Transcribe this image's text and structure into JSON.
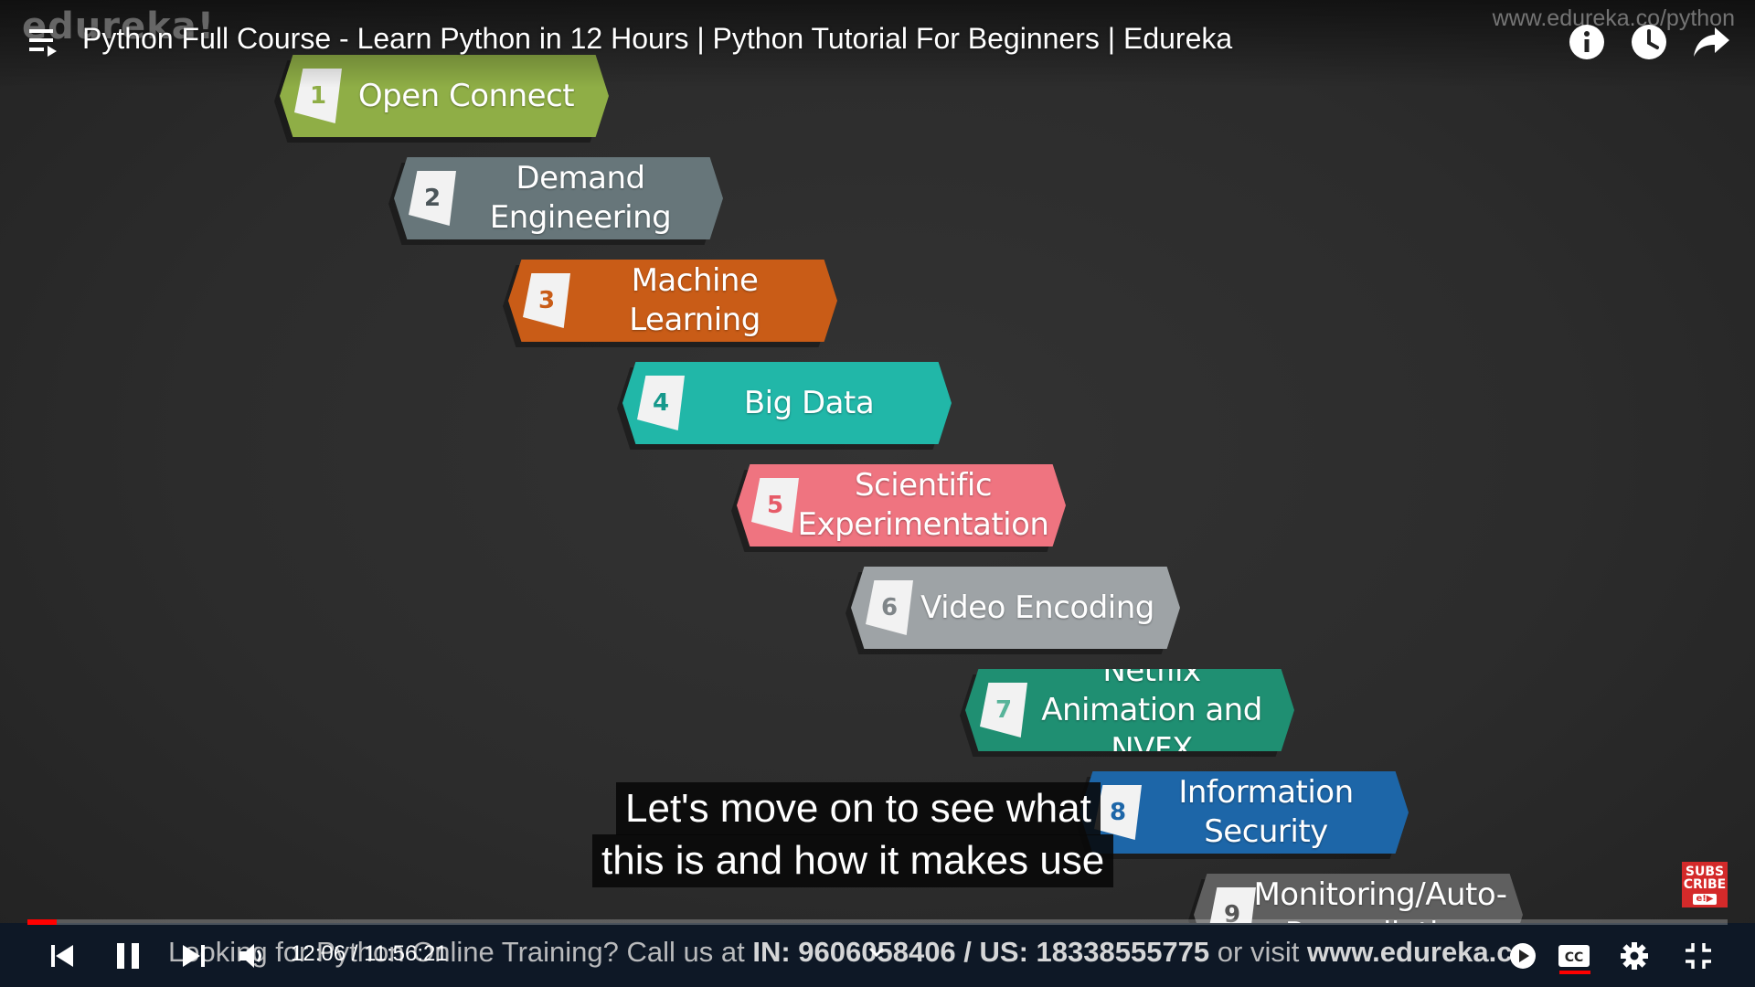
{
  "header": {
    "brand": "edureka!",
    "watermark_url": "www.edureka.co/python",
    "title": "Python Full Course - Learn Python in 12 Hours | Python Tutorial For Beginners | Edureka"
  },
  "icons": {
    "playlist": "playlist-icon",
    "info": "info-icon",
    "watch_later": "clock-icon",
    "share": "share-icon",
    "prev": "skip-previous-icon",
    "pause": "pause-icon",
    "next": "skip-next-icon",
    "volume": "volume-icon",
    "chevron": "chevron-down-icon",
    "autoplay": "autoplay-toggle-icon",
    "cc": "closed-captions-icon",
    "settings": "gear-icon",
    "fullscreen": "exit-fullscreen-icon"
  },
  "slide": {
    "blocks": [
      {
        "num": "1",
        "label": "Open Connect",
        "color": "#8fae46",
        "num_color": "#8fae46"
      },
      {
        "num": "2",
        "label": "Demand Engineering",
        "color": "#67767a",
        "num_color": "#4b5559"
      },
      {
        "num": "3",
        "label": "Machine Learning",
        "color": "#c95c17",
        "num_color": "#c95c17"
      },
      {
        "num": "4",
        "label": "Big Data",
        "color": "#21b7a8",
        "num_color": "#16998c"
      },
      {
        "num": "5",
        "label": "Scientific Experimentation",
        "color": "#ef7480",
        "num_color": "#e65b68"
      },
      {
        "num": "6",
        "label": "Video Encoding",
        "color": "#9ea3a6",
        "num_color": "#7f8588"
      },
      {
        "num": "7",
        "label": "Netflix Animation and NVFX",
        "color": "#1f8f72",
        "num_color": "#58b49a"
      },
      {
        "num": "8",
        "label": "Information Security",
        "color": "#1d66a8",
        "num_color": "#1d66a8"
      },
      {
        "num": "9",
        "label": "Monitoring/Auto-Remediation",
        "color": "#5f5f5f",
        "num_color": "#555555"
      }
    ]
  },
  "captions": {
    "line1": "Let's move on to see what",
    "line2": "this is and how it makes use"
  },
  "subscribe": {
    "line1": "SUBS",
    "line2": "CRIBE",
    "mini": "e!▶"
  },
  "ticker": {
    "part1": "Looking for Python Online Training? Call us at ",
    "part2": "IN: 9606058406 / US: 18338555775",
    "part3": " or visit ",
    "part4": "www.edureka.co"
  },
  "player": {
    "current_time": "12:06",
    "separator": " / ",
    "duration": "11:56:21",
    "progress_fraction": 0.017,
    "accent": "#ff0000"
  }
}
